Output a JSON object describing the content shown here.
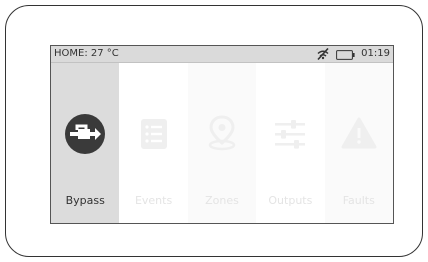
{
  "status": {
    "home_label": "HOME: 27 °C",
    "time": "01:19",
    "icons": [
      "no-signal-icon",
      "battery-icon"
    ]
  },
  "menu": {
    "items": [
      {
        "label": "Bypass",
        "icon": "bypass-icon",
        "active": true
      },
      {
        "label": "Events",
        "icon": "events-list-icon",
        "active": false
      },
      {
        "label": "Zones",
        "icon": "location-pin-icon",
        "active": false
      },
      {
        "label": "Outputs",
        "icon": "sliders-icon",
        "active": false
      },
      {
        "label": "Faults",
        "icon": "warning-icon",
        "active": false
      }
    ]
  },
  "colors": {
    "active_icon": "#3a3a3a",
    "inactive_icon": "#efefef",
    "active_tile_bg": "#dcdcdc",
    "status_bar_bg": "#dadada"
  }
}
